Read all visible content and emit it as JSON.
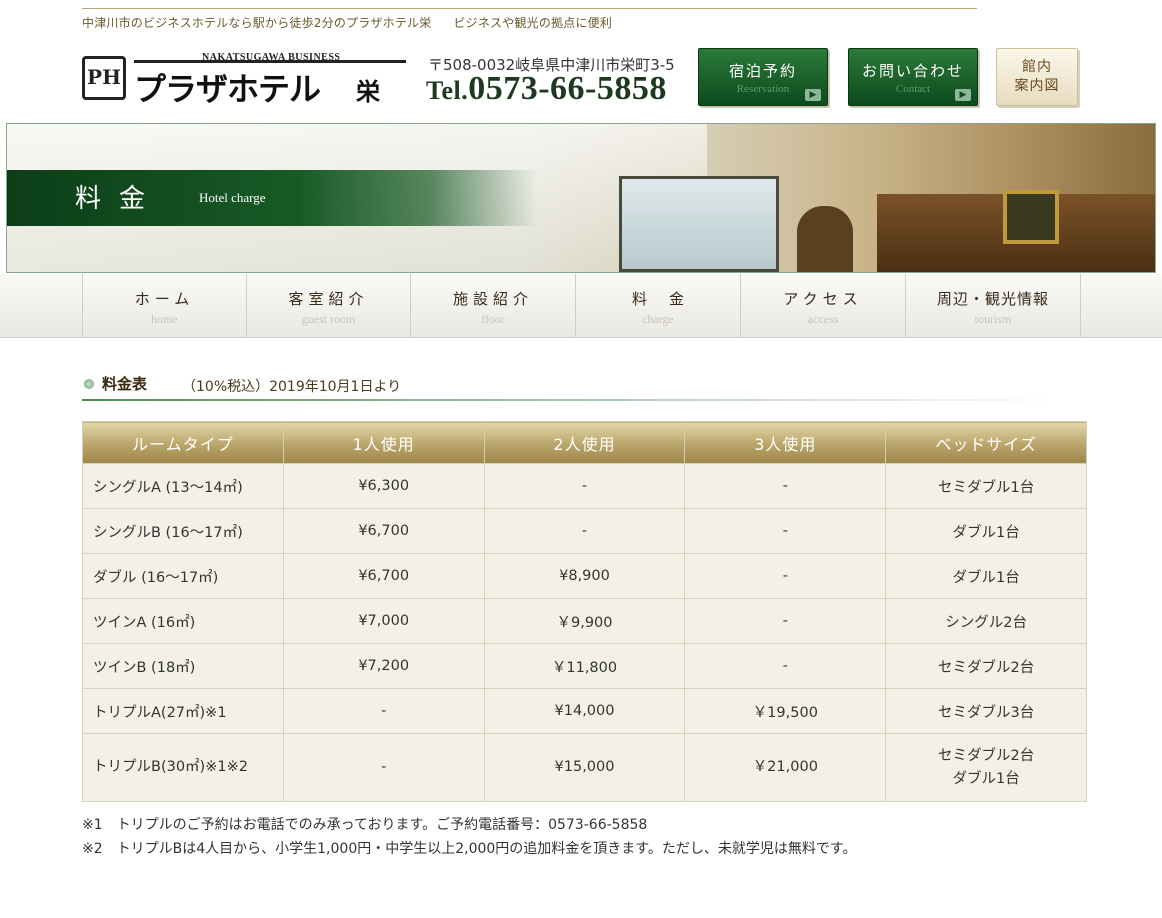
{
  "header": {
    "tagline_left": "中津川市のビジネスホテルなら駅から徒歩2分のプラザホテル栄",
    "tagline_right": "ビジネスや観光の拠点に便利",
    "logo_mark": "PH",
    "logo_sub": "NAKATSUGAWA BUSINESS",
    "logo_name": "プラザホテル",
    "logo_branch": "栄",
    "address": "〒508-0032岐阜県中津川市栄町3-5",
    "tel_prefix": "Tel.",
    "tel_number": "0573-66-5858",
    "buttons": {
      "reservation": {
        "jp": "宿泊予約",
        "en": "Reservation"
      },
      "contact": {
        "jp": "お問い合わせ",
        "en": "Contact"
      },
      "map_line1": "館内",
      "map_line2": "案内図"
    }
  },
  "banner": {
    "title": "料金",
    "subtitle": "Hotel charge"
  },
  "nav": [
    {
      "jp": "ホーム",
      "en": "home"
    },
    {
      "jp": "客室紹介",
      "en": "guest room"
    },
    {
      "jp": "施設紹介",
      "en": "floor"
    },
    {
      "jp": "料金",
      "en": "charge"
    },
    {
      "jp": "アクセス",
      "en": "access"
    },
    {
      "jp": "周辺・観光情報",
      "en": "tourism"
    }
  ],
  "section": {
    "label": "料金表",
    "note": "（10%税込）2019年10月1日より"
  },
  "table": {
    "headers": [
      "ルームタイプ",
      "1人使用",
      "2人使用",
      "3人使用",
      "ベッドサイズ"
    ],
    "rows": [
      [
        "シングルA (13〜14㎡)",
        "¥6,300",
        "-",
        "-",
        "セミダブル1台"
      ],
      [
        "シングルB (16〜17㎡)",
        "¥6,700",
        "-",
        "-",
        "ダブル1台"
      ],
      [
        "ダブル (16〜17㎡)",
        "¥6,700",
        "¥8,900",
        "-",
        "ダブル1台"
      ],
      [
        "ツインA (16㎡)",
        "¥7,000",
        "￥9,900",
        "-",
        "シングル2台"
      ],
      [
        "ツインB (18㎡)",
        "¥7,200",
        "￥11,800",
        "-",
        "セミダブル2台"
      ],
      [
        "トリプルA(27㎡)※1",
        "-",
        "¥14,000",
        "￥19,500",
        "セミダブル3台"
      ],
      [
        "トリプルB(30㎡)※1※2",
        "-",
        "¥15,000",
        "￥21,000",
        "セミダブル2台",
        "ダブル1台"
      ]
    ]
  },
  "notes": [
    "※1　トリプルのご予約はお電話でのみ承っております。ご予約電話番号：0573-66-5858",
    "※2　トリプルBは4人目から、小学生1,000円・中学生以上2,000円の追加料金を頂きます。ただし、未就学児は無料です。"
  ]
}
